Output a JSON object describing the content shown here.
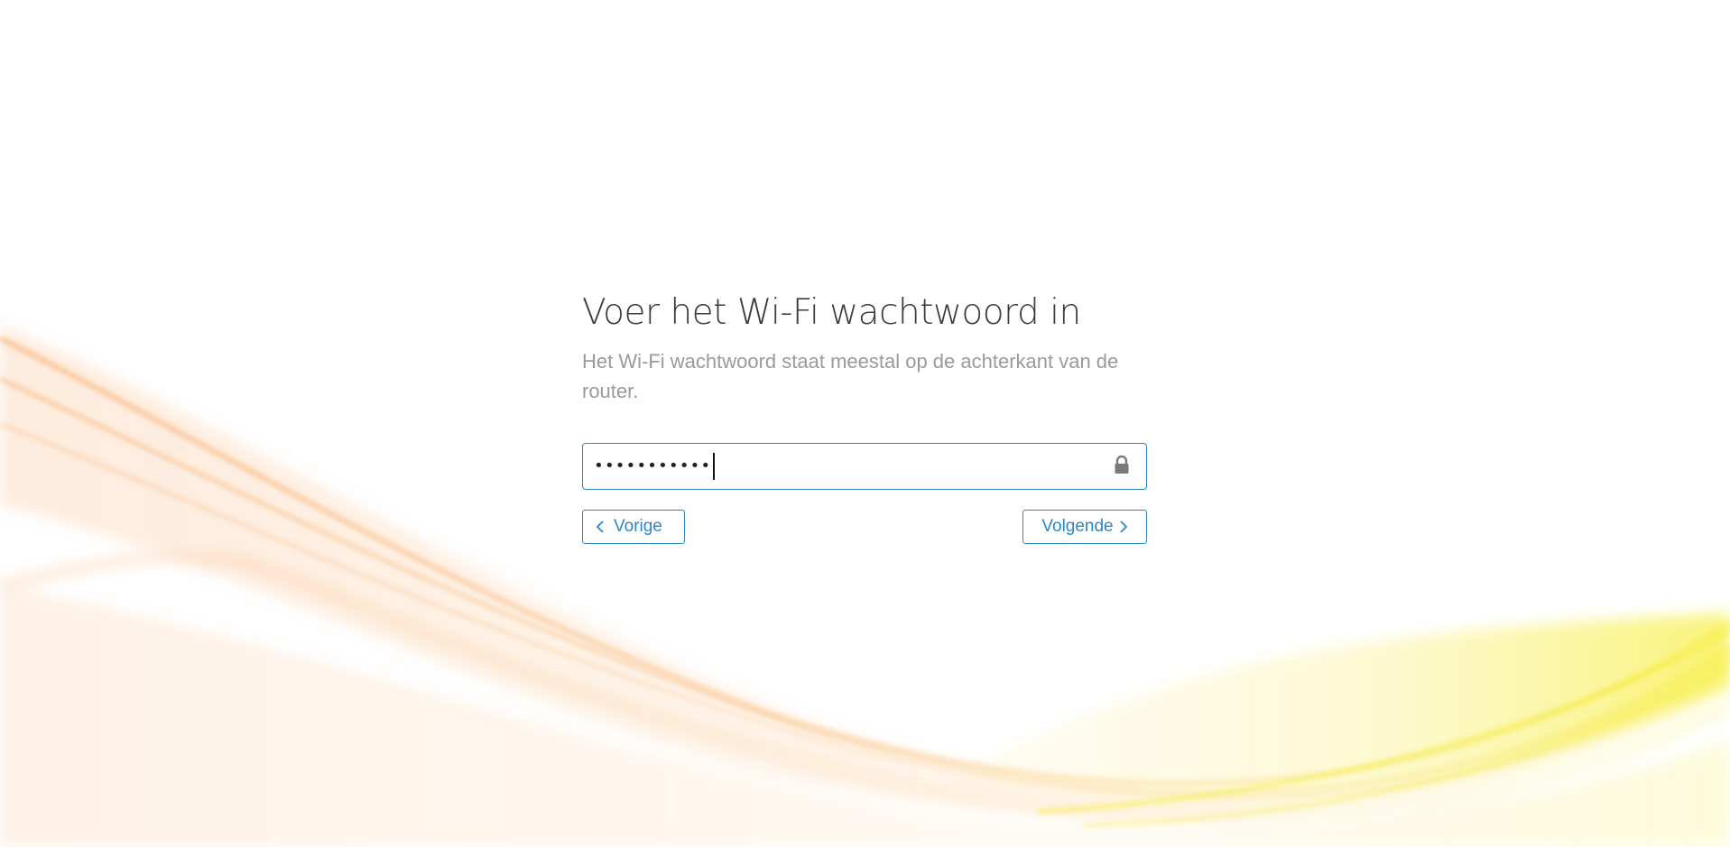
{
  "page": {
    "title": "Voer het Wi-Fi wachtwoord in",
    "subtitle": "Het Wi-Fi wachtwoord staat meestal op de achterkant van de router."
  },
  "password_field": {
    "masked_value": "•••••••••••",
    "icon": "lock-icon",
    "border_color": "#2e86c1"
  },
  "buttons": {
    "prev_label": "Vorige",
    "next_label": "Volgende"
  },
  "colors": {
    "accent": "#2e86c1",
    "wave_orange": "#f7a35c",
    "wave_yellow": "#f8e84a"
  }
}
